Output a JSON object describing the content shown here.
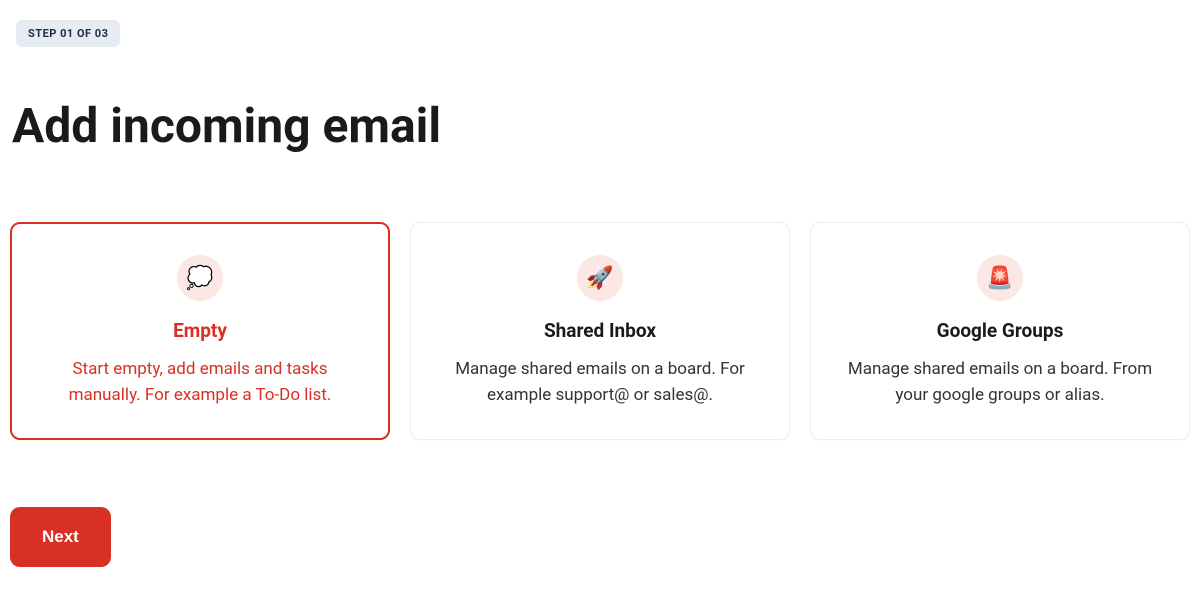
{
  "step_badge": "STEP 01 OF 03",
  "title": "Add incoming email",
  "cards": [
    {
      "icon": "💭",
      "title": "Empty",
      "desc": "Start empty, add emails and tasks manually. For example a To-Do list.",
      "selected": true
    },
    {
      "icon": "🚀",
      "title": "Shared Inbox",
      "desc": "Manage shared emails on a board. For example support@ or sales@.",
      "selected": false
    },
    {
      "icon": "🚨",
      "title": "Google Groups",
      "desc": "Manage shared emails on a board. From your google groups or alias.",
      "selected": false
    }
  ],
  "next_button": "Next"
}
